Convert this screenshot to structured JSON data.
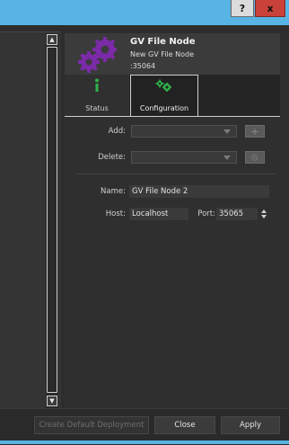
{
  "window": {
    "help_label": "?",
    "close_label": "x",
    "accent_color": "#58b4e4",
    "close_color": "#c94138"
  },
  "scrollbar": {
    "up_icon": "arrow-up-icon",
    "down_icon": "arrow-down-icon",
    "up_glyph": "▲",
    "down_glyph": "▼"
  },
  "node": {
    "icon": "gears-icon",
    "title": "GV File Node",
    "subtitle": "New GV File Node",
    "port_text": ":35064"
  },
  "tabs": [
    {
      "label": "Status",
      "icon": "info-icon"
    },
    {
      "label": "Configuration",
      "icon": "gears-icon"
    }
  ],
  "config": {
    "add_label": "Add:",
    "add_value": "",
    "add_button_glyph": "+",
    "delete_label": "Delete:",
    "delete_value": "",
    "delete_button_glyph": "⦸",
    "name_label": "Name:",
    "name_value": "GV File Node 2",
    "host_label": "Host:",
    "host_value": "Localhost",
    "port_label": "Port:",
    "port_value": "35065"
  },
  "footer": {
    "create_label": "Create Default Deployment",
    "close_label": "Close",
    "apply_label": "Apply"
  }
}
